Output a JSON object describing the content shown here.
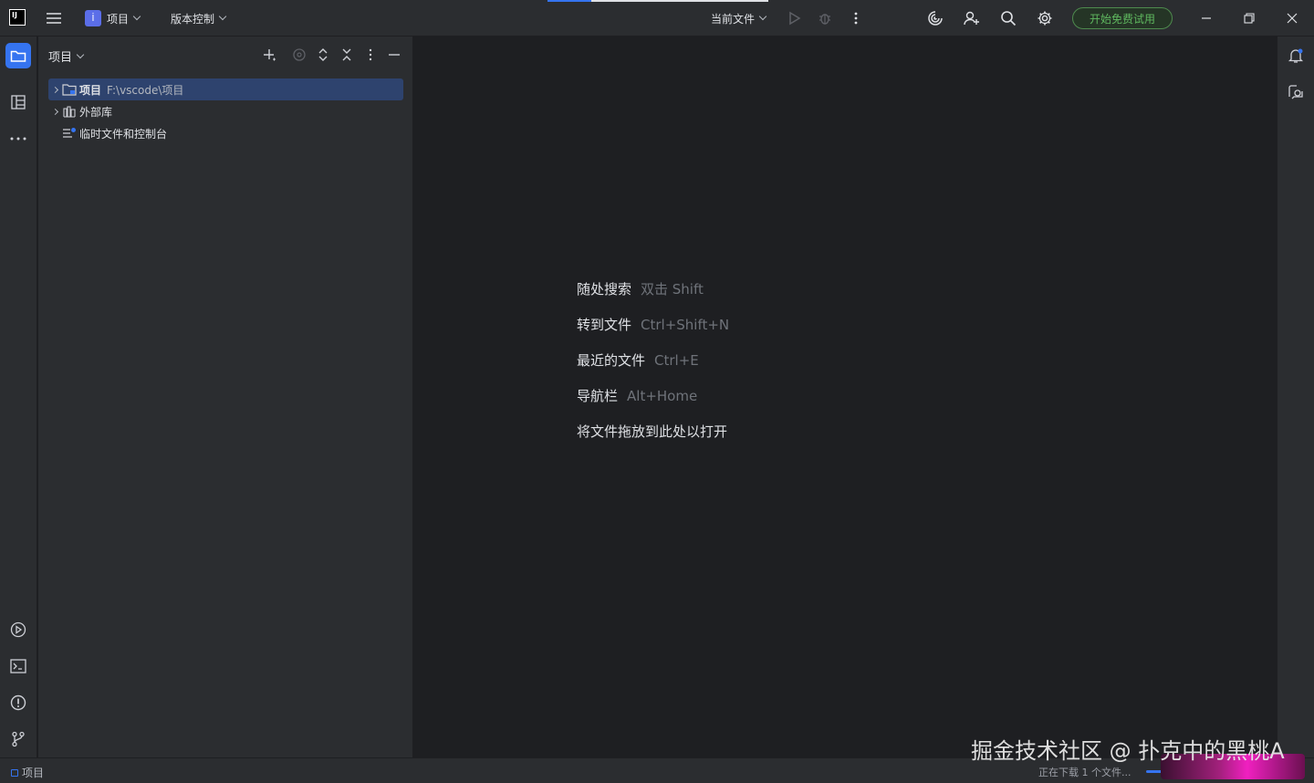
{
  "titlebar": {
    "project_badge": "İ",
    "project_menu": "项目",
    "vcs_menu": "版本控制",
    "run_config": "当前文件",
    "trial_button": "开始免费试用"
  },
  "project_panel": {
    "title": "项目",
    "tree": [
      {
        "label": "项目",
        "path": "F:\\vscode\\项目",
        "expandable": true,
        "selected": true
      },
      {
        "label": "外部库",
        "path": "",
        "expandable": true,
        "selected": false
      },
      {
        "label": "临时文件和控制台",
        "path": "",
        "expandable": false,
        "selected": false
      }
    ]
  },
  "editor": {
    "hints": [
      {
        "action": "随处搜索",
        "shortcut": "双击 Shift"
      },
      {
        "action": "转到文件",
        "shortcut": "Ctrl+Shift+N"
      },
      {
        "action": "最近的文件",
        "shortcut": "Ctrl+E"
      },
      {
        "action": "导航栏",
        "shortcut": "Alt+Home"
      },
      {
        "action": "将文件拖放到此处以打开",
        "shortcut": ""
      }
    ]
  },
  "statusbar": {
    "left_label": "项目",
    "download_status": "正在下载 1 个文件..."
  },
  "watermark": "掘金技术社区 @ 扑克中的黑桃A",
  "colors": {
    "accent": "#3574f0",
    "selection": "#2e436e",
    "trial_green": "#5fb85f"
  }
}
